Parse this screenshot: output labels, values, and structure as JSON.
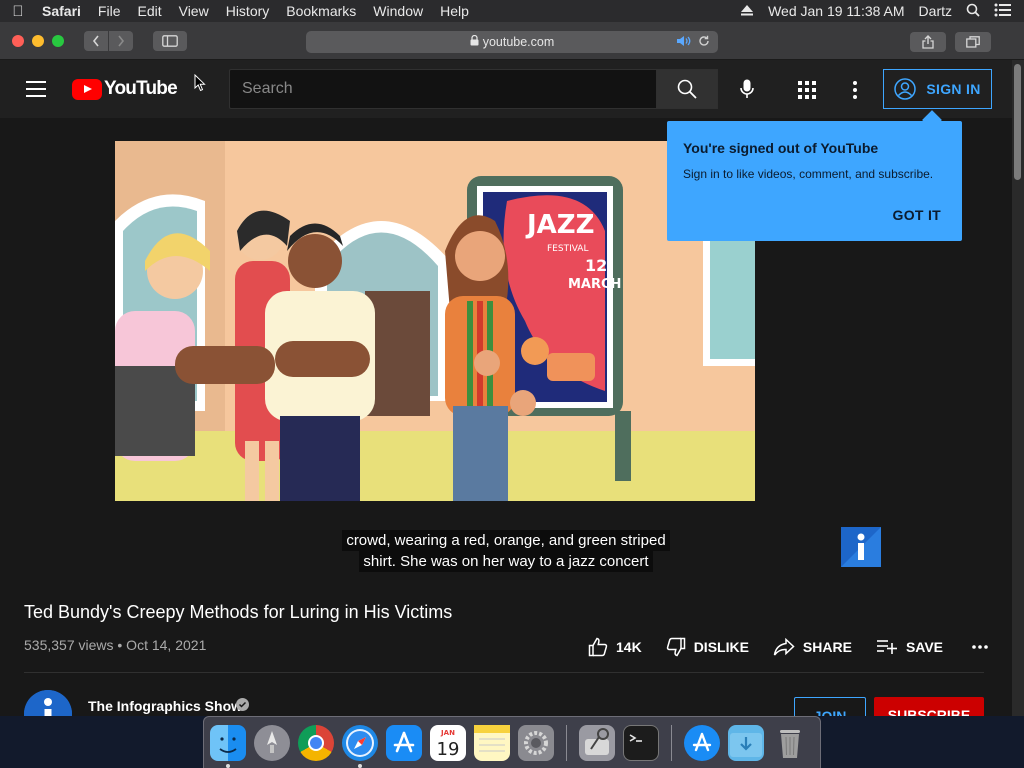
{
  "menubar": {
    "app": "Safari",
    "items": [
      "File",
      "Edit",
      "View",
      "History",
      "Bookmarks",
      "Window",
      "Help"
    ],
    "clock": "Wed Jan 19  11:38 AM",
    "user": "Dartz"
  },
  "safari": {
    "url": "youtube.com"
  },
  "youtube": {
    "logo_text": "YouTube",
    "search_placeholder": "Search",
    "sign_in_label": "SIGN IN",
    "accent": "#3ea6ff",
    "brand_red": "#ff0000"
  },
  "tooltip": {
    "title": "You're signed out of YouTube",
    "body": "Sign in to like videos, comment, and subscribe.",
    "button": "GOT IT"
  },
  "video": {
    "poster_heading": "JAZZ",
    "poster_sub": "FESTIVAL",
    "poster_date": "12",
    "poster_month": "MARCH",
    "captions": [
      "crowd, wearing a red, orange, and green striped",
      "shirt. She was on her way to a jazz concert"
    ],
    "title": "Ted Bundy's Creepy Methods for Luring in His Victims",
    "meta": "535,357 views • Oct 14, 2021",
    "likes": "14K",
    "dislike_label": "DISLIKE",
    "share_label": "SHARE",
    "save_label": "SAVE"
  },
  "channel": {
    "name": "The Infographics Show",
    "join_label": "JOIN",
    "subscribe_label": "SUBSCRIBE"
  },
  "dock": {
    "calendar_month": "JAN",
    "calendar_day": "19"
  }
}
